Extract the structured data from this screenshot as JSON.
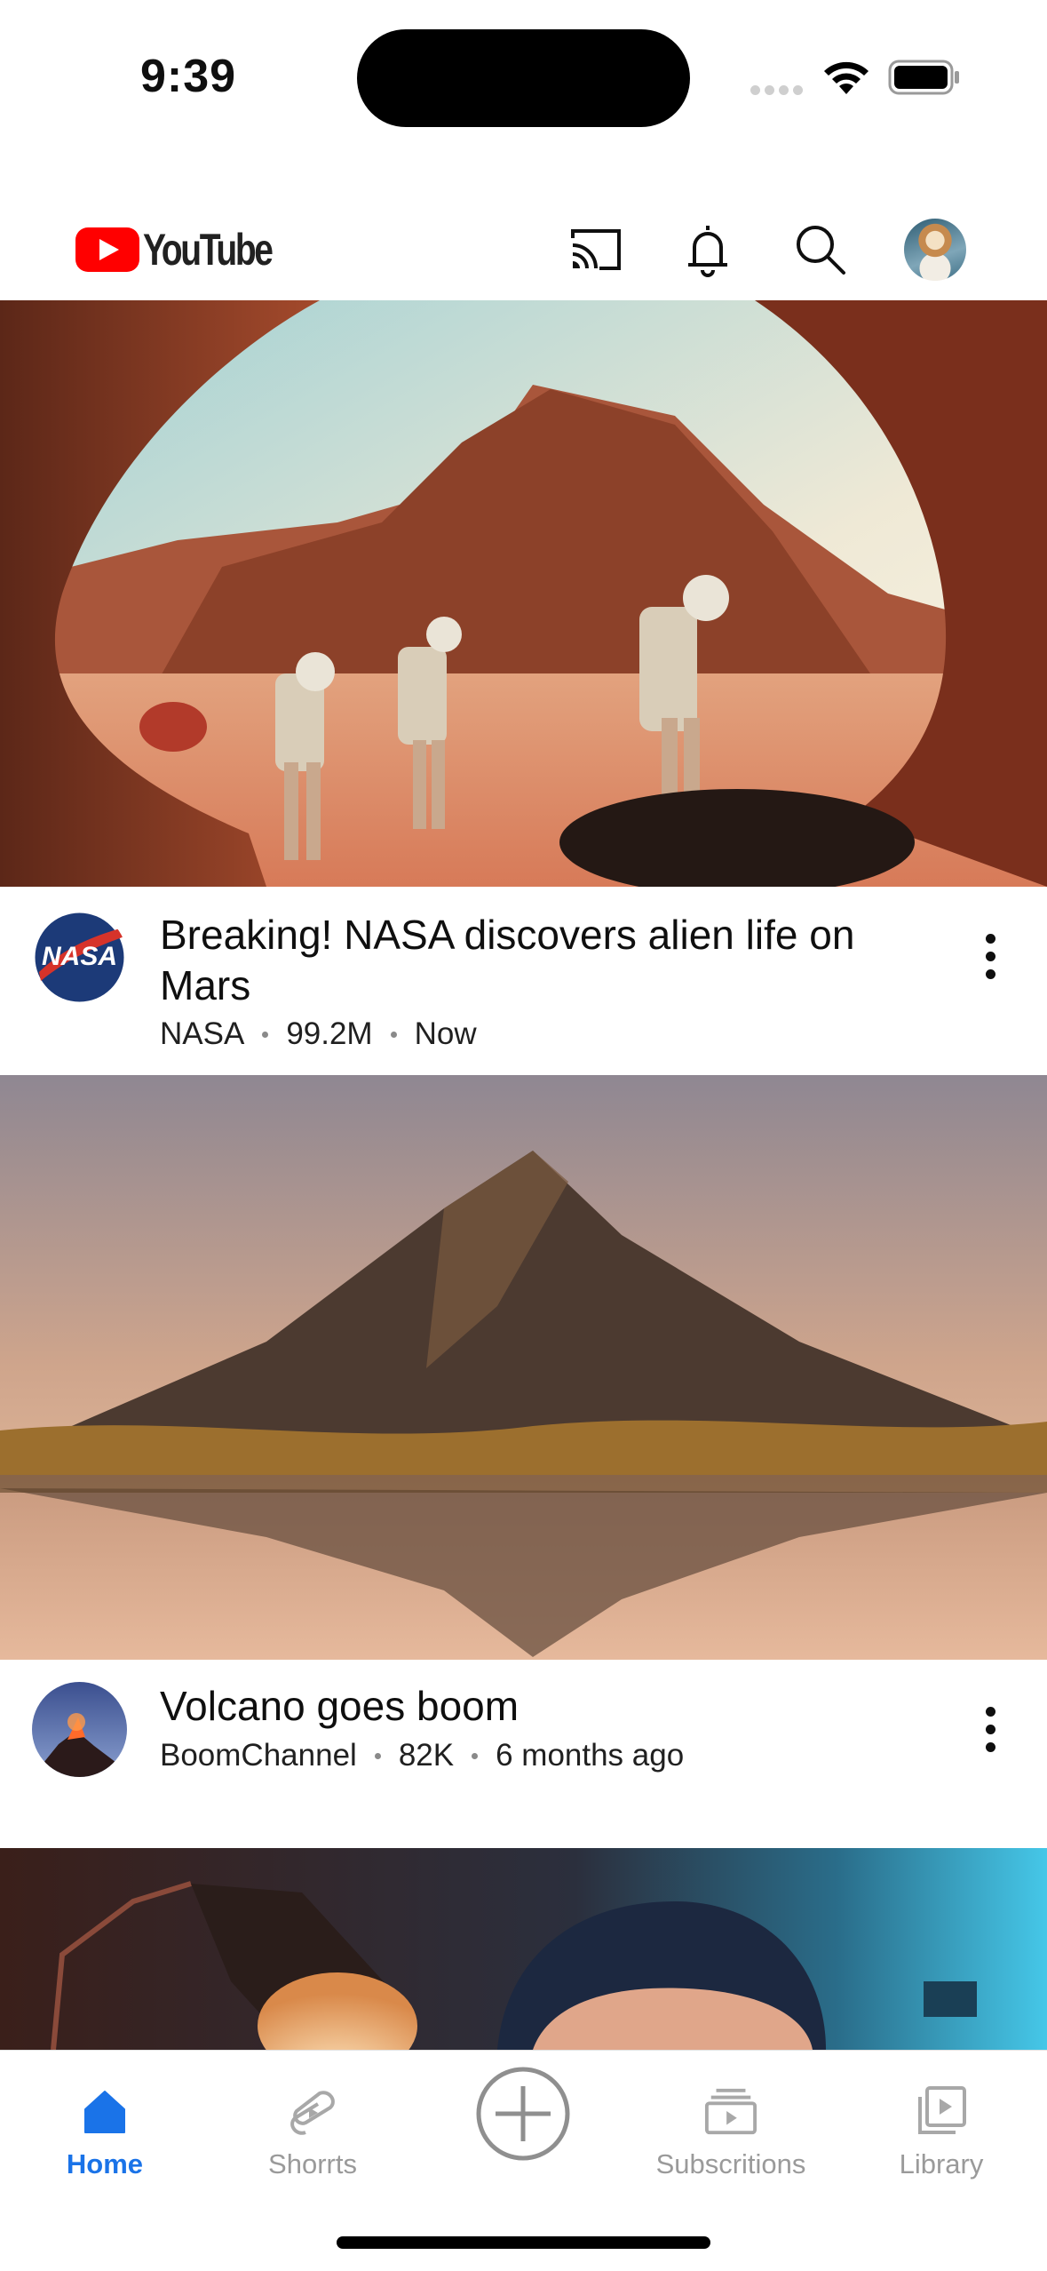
{
  "status_bar": {
    "time": "9:39"
  },
  "header": {
    "logo_text": "YouTube",
    "icons": [
      "cast-icon",
      "bell-icon",
      "search-icon",
      "avatar"
    ],
    "brand_color": "#ff0000"
  },
  "feed": [
    {
      "title": "Breaking! NASA discovers alien life on Mars",
      "channel": "NASA",
      "views": "99.2M",
      "age": "Now",
      "thumbnail": "astronauts on mars"
    },
    {
      "title": "Volcano goes boom",
      "channel": "BoomChannel",
      "views": "82K",
      "age": "6 months ago",
      "thumbnail": "volcano reflection on lake"
    },
    {
      "thumbnail": "boy under desk lamp"
    }
  ],
  "bottom_nav": {
    "items": [
      {
        "label": "Home",
        "icon": "home-icon",
        "active": true
      },
      {
        "label": "Shorrts",
        "icon": "shorts-icon",
        "active": false
      },
      {
        "label": "",
        "icon": "create-plus-icon",
        "active": false
      },
      {
        "label": "Subscritions",
        "icon": "subscriptions-icon",
        "active": false
      },
      {
        "label": "Library",
        "icon": "library-icon",
        "active": false
      }
    ],
    "active_color": "#1a73e8",
    "inactive_color": "#9a9a9a"
  }
}
